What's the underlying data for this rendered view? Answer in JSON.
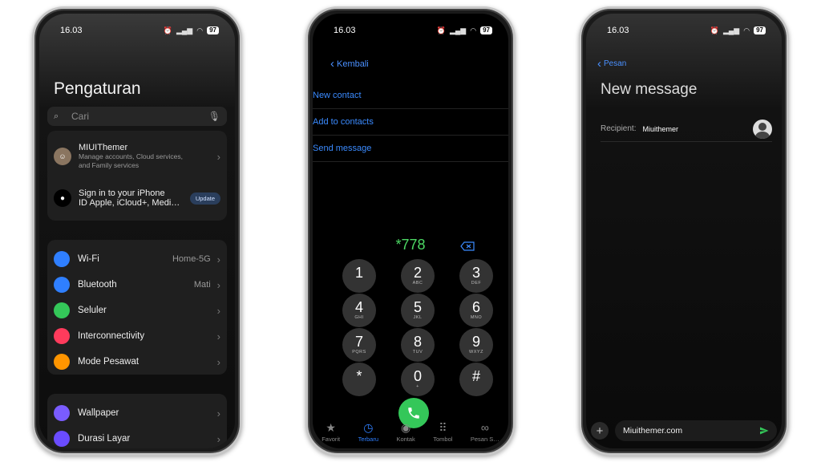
{
  "phone1": {
    "time": "16.03",
    "battery": "97",
    "title": "Pengaturan",
    "search_placeholder": "Cari",
    "account": {
      "name": "MIUIThemer",
      "sub1": "Manage accounts, Cloud services,",
      "sub2": "and Family services"
    },
    "signin": {
      "line1": "Sign in to your iPhone",
      "line2": "ID Apple, iCloud+, Medi…",
      "button": "Update"
    },
    "group1": [
      {
        "label": "Wi-Fi",
        "value": "Home-5G",
        "icon": "wifi-icon",
        "color": "#2f7fff"
      },
      {
        "label": "Bluetooth",
        "value": "Mati",
        "icon": "bluetooth-icon",
        "color": "#2f7fff"
      },
      {
        "label": "Seluler",
        "value": "",
        "icon": "cellular-icon",
        "color": "#34c759"
      },
      {
        "label": "Interconnectivity",
        "value": "",
        "icon": "interconnectivity-icon",
        "color": "#ff3b5c"
      },
      {
        "label": "Mode Pesawat",
        "value": "",
        "icon": "airplane-icon",
        "color": "#ff9500"
      }
    ],
    "group2": [
      {
        "label": "Wallpaper",
        "icon": "wallpaper-icon",
        "color": "#7a5cff"
      },
      {
        "label": "Durasi Layar",
        "icon": "hourglass-icon",
        "color": "#6a4cff"
      }
    ]
  },
  "phone2": {
    "time": "16.03",
    "battery": "97",
    "back_label": "Kembali",
    "links": [
      "New contact",
      "Add to contacts",
      "Send message"
    ],
    "dialed": "*778",
    "keys": [
      {
        "n": "1",
        "l": ""
      },
      {
        "n": "2",
        "l": "ABC"
      },
      {
        "n": "3",
        "l": "DEF"
      },
      {
        "n": "4",
        "l": "GHI"
      },
      {
        "n": "5",
        "l": "JKL"
      },
      {
        "n": "6",
        "l": "MNO"
      },
      {
        "n": "7",
        "l": "PQRS"
      },
      {
        "n": "8",
        "l": "TUV"
      },
      {
        "n": "9",
        "l": "WXYZ"
      },
      {
        "n": "*",
        "l": ""
      },
      {
        "n": "0",
        "l": "+"
      },
      {
        "n": "#",
        "l": ""
      }
    ],
    "tabs": [
      {
        "label": "Favorit",
        "icon": "★"
      },
      {
        "label": "Terbaru",
        "icon": "◷"
      },
      {
        "label": "Kontak",
        "icon": "◉"
      },
      {
        "label": "Tombol",
        "icon": "⠿"
      },
      {
        "label": "Pesan S…",
        "icon": "∞"
      }
    ]
  },
  "phone3": {
    "time": "16.03",
    "battery": "97",
    "back_label": "Pesan",
    "title": "New message",
    "recipient_label": "Recipient:",
    "recipient_value": "Miuithemer",
    "message_text": "Miuithemer.com"
  }
}
